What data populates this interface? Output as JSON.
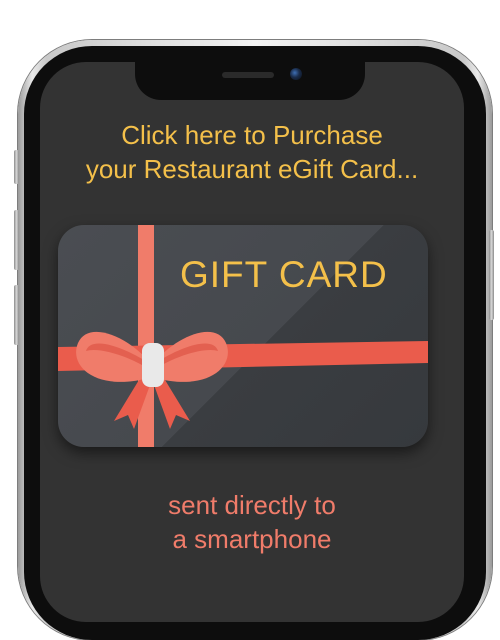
{
  "promo": {
    "headline_line1": "Click here to Purchase",
    "headline_line2": "your Restaurant eGift Card...",
    "card_title": "GIFT CARD",
    "subtitle_line1": "sent directly to",
    "subtitle_line2": "a smartphone"
  },
  "colors": {
    "accent_yellow": "#f4c04a",
    "ribbon_coral": "#f07c6a",
    "screen_bg": "#333333",
    "card_bg": "#46494e"
  },
  "icons": {
    "device": "smartphone",
    "card_decoration": "gift-bow-icon"
  }
}
